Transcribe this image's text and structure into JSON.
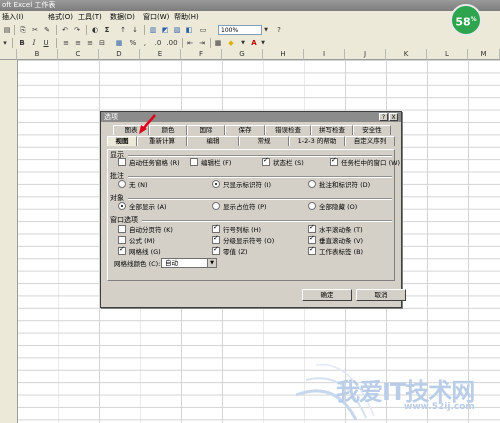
{
  "window": {
    "title": "oft Excel 工作表"
  },
  "menu": [
    "插入(I)",
    "格式(O)",
    "工具(T)",
    "数据(D)",
    "窗口(W)",
    "帮助(H)"
  ],
  "toolbar": {
    "zoom": "100%"
  },
  "badge": {
    "value": "58",
    "unit": "%"
  },
  "columns": [
    "B",
    "C",
    "D",
    "E",
    "F",
    "G",
    "H",
    "I",
    "J",
    "K",
    "L",
    "M",
    "N",
    "O"
  ],
  "dialog": {
    "title": "选项",
    "help_btn": "?",
    "close_btn": "X",
    "tabs_row1": [
      "图表",
      "颜色",
      "国际",
      "保存",
      "错误检查",
      "拼写检查",
      "安全性"
    ],
    "tabs_row2": [
      "视图",
      "重新计算",
      "编辑",
      "常规",
      "1-2-3 的帮助",
      "自定义序列"
    ],
    "show": {
      "label": "显示",
      "options": [
        {
          "label": "启动任务窗格 (R)",
          "checked": false
        },
        {
          "label": "编辑栏 (F)",
          "checked": false
        },
        {
          "label": "状态栏 (S)",
          "checked": true
        },
        {
          "label": "任务栏中的窗口 (W)",
          "checked": true
        }
      ]
    },
    "comments": {
      "label": "批注",
      "options": [
        {
          "label": "无 (N)",
          "selected": false
        },
        {
          "label": "只显示标识符 (I)",
          "selected": true
        },
        {
          "label": "批注和标识符 (D)",
          "selected": false
        }
      ]
    },
    "objects": {
      "label": "对象",
      "options": [
        {
          "label": "全部显示 (A)",
          "selected": true
        },
        {
          "label": "显示占位符 (P)",
          "selected": false
        },
        {
          "label": "全部隐藏 (O)",
          "selected": false
        }
      ]
    },
    "window_options": {
      "label": "窗口选项",
      "items": [
        {
          "label": "自动分页符 (K)",
          "checked": false
        },
        {
          "label": "行号列标 (H)",
          "checked": true
        },
        {
          "label": "水平滚动条 (T)",
          "checked": true
        },
        {
          "label": "公式 (M)",
          "checked": false
        },
        {
          "label": "分级显示符号 (O)",
          "checked": true
        },
        {
          "label": "垂直滚动条 (V)",
          "checked": true
        },
        {
          "label": "网格线 (G)",
          "checked": true
        },
        {
          "label": "零值 (Z)",
          "checked": true
        },
        {
          "label": "工作表标签 (B)",
          "checked": true
        }
      ],
      "gridline_color_label": "网格线颜色 (C):",
      "gridline_color_value": "自动"
    },
    "ok": "确定",
    "cancel": "取消"
  },
  "watermark": {
    "text": "我爱IT技术网",
    "url": "www.52ij.com"
  }
}
